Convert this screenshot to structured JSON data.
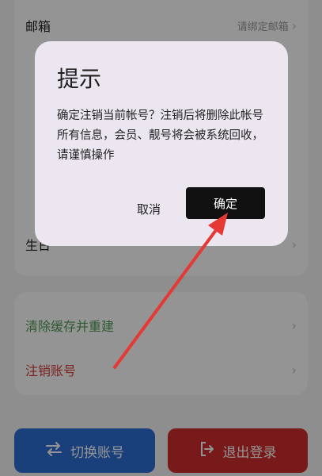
{
  "settings": {
    "email_label": "邮箱",
    "email_value": "请绑定邮箱",
    "partial_row_label": "生日",
    "clear_cache_label": "清除缓存并重建",
    "cancel_account_label": "注销账号"
  },
  "bottom_bar": {
    "switch_label": "切换账号",
    "logout_label": "退出登录"
  },
  "dialog": {
    "title": "提示",
    "message": "确定注销当前帐号？注销后将删除此帐号所有信息，会员、靓号将会被系统回收，请谨慎操作",
    "cancel_label": "取消",
    "confirm_label": "确定"
  },
  "colors": {
    "accent_green": "#4f9a55",
    "danger_red": "#d93a3a",
    "primary_blue": "#2d6fd6",
    "logout_red": "#cf2d2d",
    "annotation_red": "#e53935"
  },
  "icons": {
    "chevron": "chevron-right-icon",
    "switch": "swap-arrows-icon",
    "logout": "logout-icon"
  }
}
